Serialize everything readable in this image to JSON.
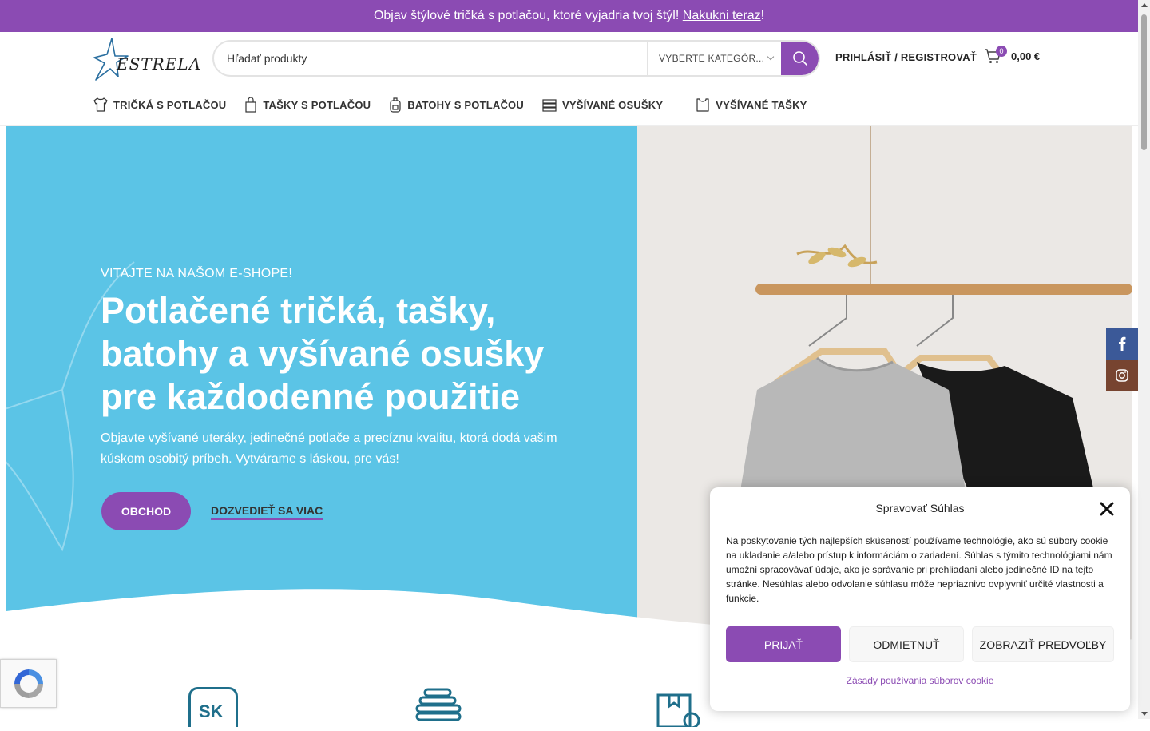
{
  "colors": {
    "brand": "#8b4bb3",
    "hero_blue": "#5bc4e6",
    "facebook": "#3b5998",
    "instagram": "#774430",
    "icon_teal": "#1f6f8b"
  },
  "announcement": {
    "text": "Objav štýlové tričká s potlačou, ktoré vyjadria tvoj štýl! ",
    "link": "Nakukni teraz",
    "suffix": "!"
  },
  "header": {
    "logo_text": "ESTRELA",
    "search_placeholder": "Hľadať produkty",
    "category_label": "VYBERTE KATEGÓR...",
    "login_label": "PRIHLÁSIŤ / REGISTROVAŤ",
    "cart_count": "0",
    "cart_total": "0,00 €"
  },
  "nav": {
    "items": [
      {
        "label": "TRIČKÁ S POTLAČOU",
        "icon": "tshirt-icon"
      },
      {
        "label": "TAŠKY S POTLAČOU",
        "icon": "bag-icon"
      },
      {
        "label": "BATOHY S POTLAČOU",
        "icon": "backpack-icon"
      },
      {
        "label": "VYŠÍVANÉ OSUŠKY",
        "icon": "towel-icon"
      },
      {
        "label": "VYŠÍVANÉ TAŠKY",
        "icon": "tote-icon"
      }
    ]
  },
  "hero": {
    "eyebrow": "VITAJTE NA NAŠOM E-SHOPE!",
    "title": "Potlačené tričká, tašky, batohy a vyšívané osušky pre každodenné použitie",
    "description": "Objavte vyšívané uteráky, jedinečné potlače a precíznu kvalitu, ktorá dodá vašim kúskom osobitý príbeh. Vytvárame s láskou, pre vás!",
    "shop_button": "OBCHOD",
    "more_link": "DOZVEDIEŤ SA VIAC"
  },
  "features": {
    "sk_badge": "SK"
  },
  "cookie": {
    "title": "Spravovať Súhlas",
    "text": "Na poskytovanie tých najlepších skúseností používame technológie, ako sú súbory cookie na ukladanie a/alebo prístup k informáciám o zariadení. Súhlas s týmito technológiami nám umožní spracovávať údaje, ako je správanie pri prehliadaní alebo jedinečné ID na tejto stránke. Nesúhlas alebo odvolanie súhlasu môže nepriaznivo ovplyvniť určité vlastnosti a funkcie.",
    "accept": "PRIJAŤ",
    "deny": "ODMIETNUŤ",
    "preferences": "ZOBRAZIŤ PREDVOĽBY",
    "policy_link": "Zásady používania súborov cookie"
  }
}
